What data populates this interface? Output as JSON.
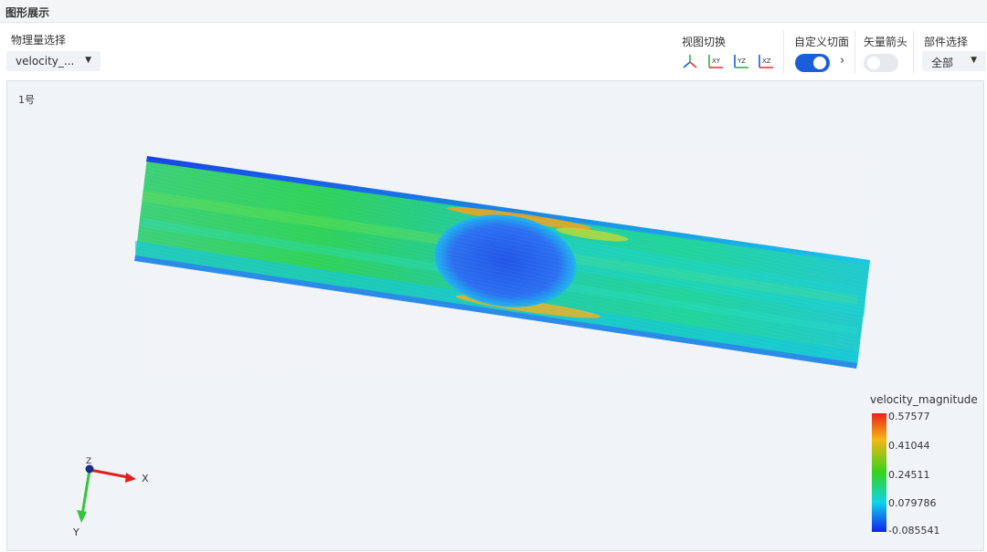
{
  "panel": {
    "title": "图形展示"
  },
  "toolbar": {
    "physical_quantity_label": "物理量选择",
    "physical_quantity_value": "velocity_...",
    "view_switch_label": "视图切换",
    "view_buttons": [
      "XY",
      "YZ",
      "XZ"
    ],
    "custom_section_label": "自定义切面",
    "custom_section_enabled": true,
    "vector_arrow_label": "矢量箭头",
    "vector_arrow_enabled": false,
    "part_select_label": "部件选择",
    "part_select_value": "全部"
  },
  "viewport": {
    "label": "1号",
    "axes": {
      "x": "X",
      "y": "Y",
      "z": "Z"
    }
  },
  "legend": {
    "title": "velocity_magnitude",
    "ticks": [
      "0.57577",
      "0.41044",
      "0.24511",
      "0.079786",
      "-0.085541"
    ],
    "colors": [
      "#e8231a",
      "#f7b615",
      "#34d31c",
      "#0fd4e8",
      "#1022f0"
    ]
  }
}
